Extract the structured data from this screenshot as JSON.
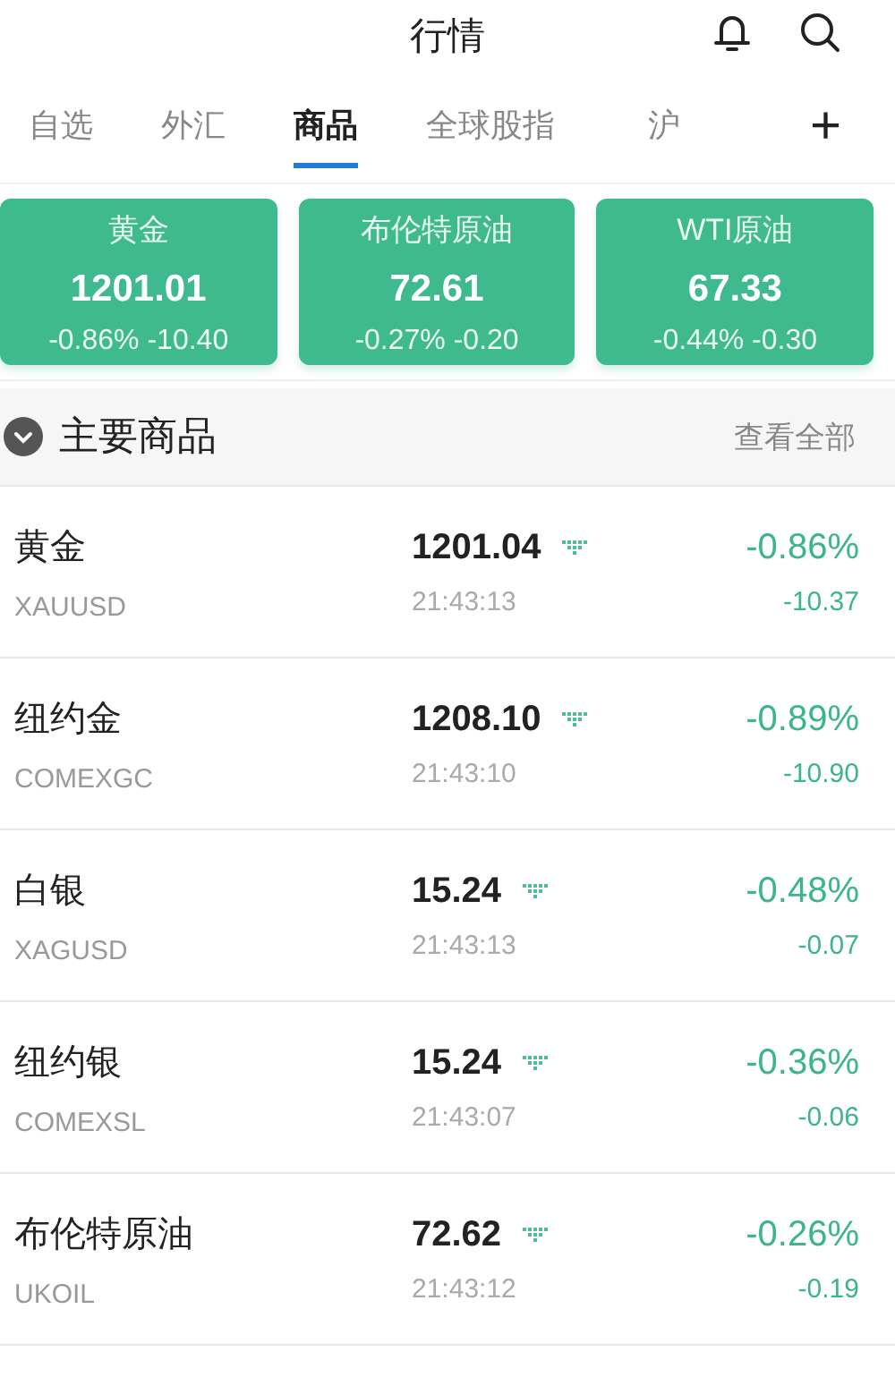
{
  "header": {
    "title": "行情"
  },
  "tabs": [
    {
      "label": "自选",
      "selected": false
    },
    {
      "label": "外汇",
      "selected": false
    },
    {
      "label": "商品",
      "selected": true
    },
    {
      "label": "全球股指",
      "selected": false
    },
    {
      "label": "沪",
      "selected": false
    }
  ],
  "add_tab": "+",
  "cards": [
    {
      "name": "黄金",
      "price": "1201.01",
      "change": "-0.86% -10.40"
    },
    {
      "name": "布伦特原油",
      "price": "72.61",
      "change": "-0.27% -0.20"
    },
    {
      "name": "WTI原油",
      "price": "67.33",
      "change": "-0.44% -0.30"
    }
  ],
  "section": {
    "title": "主要商品",
    "expanded": true,
    "link": "查看全部"
  },
  "rows": [
    {
      "name": "黄金",
      "code": "XAUUSD",
      "price": "1201.04",
      "time": "21:43:13",
      "percent": "-0.86%",
      "change": "-10.37",
      "falling": true
    },
    {
      "name": "纽约金",
      "code": "COMEXGC",
      "price": "1208.10",
      "time": "21:43:10",
      "percent": "-0.89%",
      "change": "-10.90",
      "falling": true
    },
    {
      "name": "白银",
      "code": "XAGUSD",
      "price": "15.24",
      "time": "21:43:13",
      "percent": "-0.48%",
      "change": "-0.07",
      "falling": true
    },
    {
      "name": "纽约银",
      "code": "COMEXSL",
      "price": "15.24",
      "time": "21:43:07",
      "percent": "-0.36%",
      "change": "-0.06",
      "falling": true
    },
    {
      "name": "布伦特原油",
      "code": "UKOIL",
      "price": "72.62",
      "time": "21:43:12",
      "percent": "-0.26%",
      "change": "-0.19",
      "falling": true
    }
  ]
}
